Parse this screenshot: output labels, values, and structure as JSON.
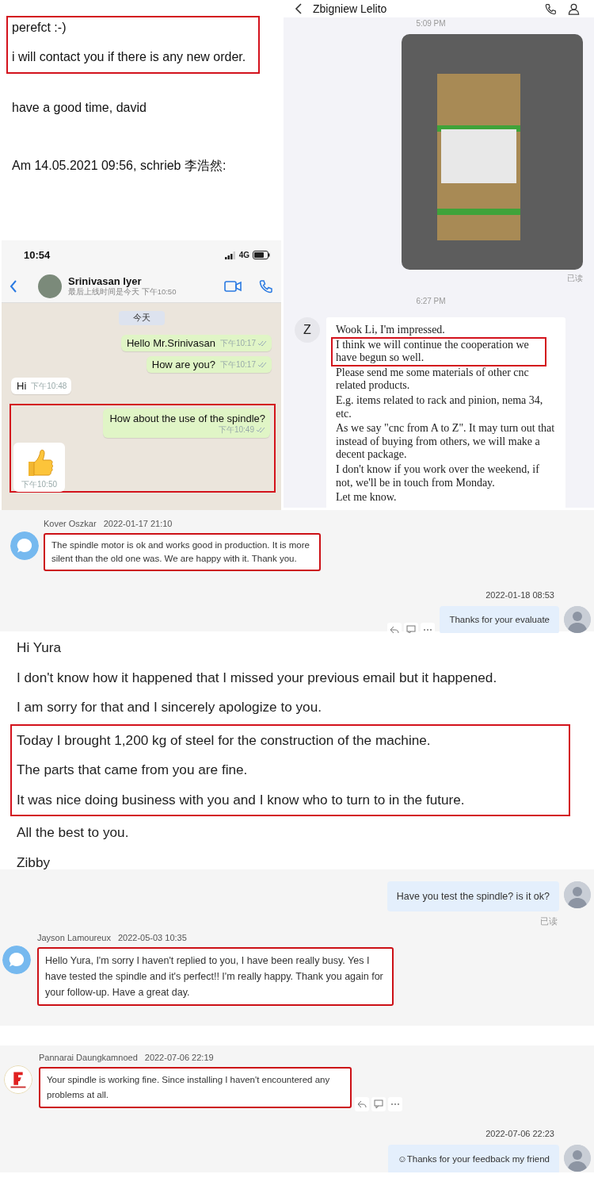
{
  "email_top": {
    "blocks": [
      {
        "highlighted": true,
        "paragraphs": [
          "perefct :-)",
          "i will contact you if there is any new order."
        ]
      },
      {
        "highlighted": false,
        "paragraphs": [
          "have a good time, david",
          "Am 14.05.2021 09:56, schrieb 李浩然:"
        ]
      }
    ]
  },
  "whatsapp": {
    "status_time": "10:54",
    "network": "4G",
    "contact_name": "Srinivasan Iyer",
    "last_seen": "最后上线时间是今天 下午10:50",
    "date_chip": "今天",
    "messages": [
      {
        "kind": "text",
        "outgoing": true,
        "text": "Hello Mr.Srinivasan",
        "time": "下午10:17",
        "highlighted": false
      },
      {
        "kind": "text",
        "outgoing": true,
        "text": "How are you?",
        "time": "下午10:17",
        "highlighted": false
      },
      {
        "kind": "text",
        "outgoing": false,
        "text": "Hi",
        "time": "下午10:48",
        "highlighted": false
      },
      {
        "kind": "text",
        "outgoing": true,
        "text": "How about the use of the spindle?",
        "time": "下午10:49",
        "highlighted": true
      },
      {
        "kind": "sticker",
        "outgoing": false,
        "time": "下午10:50",
        "highlighted": true
      }
    ]
  },
  "chat_right": {
    "contact_name": "Zbigniew Lelito",
    "items": [
      {
        "kind": "time",
        "text": "5:09 PM"
      },
      {
        "kind": "photo",
        "status": "已读"
      },
      {
        "kind": "time",
        "text": "6:27 PM"
      },
      {
        "kind": "message",
        "avatar": "Z",
        "paragraphs": [
          {
            "text": "Wook Li, I'm impressed.",
            "highlighted": false
          },
          {
            "text": "I think we will continue the cooperation we have begun so well.",
            "highlighted": true
          },
          {
            "text": "Please send me some materials of other cnc related products.",
            "highlighted": false
          },
          {
            "text": "E.g. items related to rack and pinion, nema 34, etc.",
            "highlighted": false
          },
          {
            "text": "As we say \"cnc from A to Z\". It may turn out that instead of buying from others, we will make a decent package.",
            "highlighted": false
          },
          {
            "text": "I don't know if you work over the weekend, if not, we'll be in touch from Monday.",
            "highlighted": false
          },
          {
            "text": "Let me know.",
            "highlighted": false
          }
        ]
      }
    ]
  },
  "chat_kover": {
    "messages": [
      {
        "kind": "bubble",
        "outgoing": false,
        "sender": "Kover Oszkar",
        "time": "2022-01-17 21:10",
        "text": "The spindle motor is ok and works good in production. It is more silent than the old one was. We are happy with it. Thank you.",
        "highlighted": true,
        "actions": false
      },
      {
        "kind": "photo",
        "outgoing": true,
        "time": "2022-01-18 08:53",
        "text": "Thanks for your evaluate",
        "highlighted": false,
        "actions": true
      }
    ]
  },
  "email_yura": {
    "blocks": [
      {
        "highlighted": false,
        "paragraphs": [
          "Hi Yura",
          "I don't know how it happened that I missed your previous email but it happened.",
          "I am sorry for that and I sincerely apologize to you."
        ]
      },
      {
        "highlighted": true,
        "paragraphs": [
          "Today I brought 1,200 kg of steel for the construction of the machine.",
          "The parts that came from you are fine.",
          "It was nice doing business with you and I know who to turn to in the future."
        ]
      },
      {
        "highlighted": false,
        "paragraphs": [
          "All the best to you.",
          "Zibby"
        ]
      }
    ]
  },
  "chat_jayson": {
    "messages": [
      {
        "kind": "photo",
        "outgoing": true,
        "text": "Have you test the spindle? is it ok?",
        "status": "已读",
        "highlighted": false,
        "actions": false
      },
      {
        "kind": "bubble",
        "outgoing": false,
        "sender": "Jayson Lamoureux",
        "time": "2022-05-03 10:35",
        "text": "Hello Yura, I'm sorry I haven't replied to you, I have been really busy. Yes I have tested the spindle and it's perfect!! I'm really happy. Thank you again for your follow-up. Have a great day.",
        "highlighted": true,
        "actions": false
      }
    ]
  },
  "chat_pannarai": {
    "messages": [
      {
        "kind": "logo",
        "outgoing": false,
        "sender": "Pannarai Daungkamnoed",
        "time": "2022-07-06 22:19",
        "text": "Your spindle is working fine. Since installing I haven't encountered any problems at all.",
        "highlighted": true,
        "actions": true
      },
      {
        "kind": "photo",
        "outgoing": true,
        "time": "2022-07-06 22:23",
        "text": "☺Thanks for your feedback my friend",
        "highlighted": false,
        "actions": false
      }
    ]
  }
}
